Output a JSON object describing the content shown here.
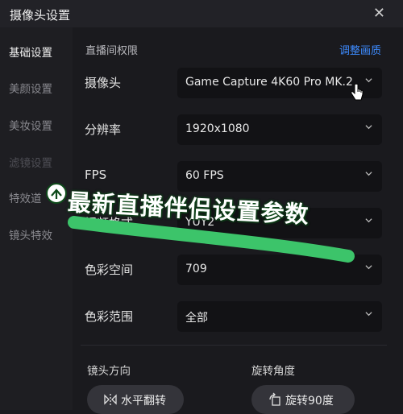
{
  "window": {
    "title": "摄像头设置",
    "close_glyph": "✕"
  },
  "sidebar": {
    "items": [
      {
        "label": "基础设置",
        "state": "active"
      },
      {
        "label": "美颜设置",
        "state": "normal"
      },
      {
        "label": "美妆设置",
        "state": "normal"
      },
      {
        "label": "滤镜设置",
        "state": "dim"
      },
      {
        "label": "特效道",
        "state": "normal"
      },
      {
        "label": "镜头特效",
        "state": "normal"
      }
    ]
  },
  "main": {
    "section_title": "直播间权限",
    "adjust_link": "调整画质",
    "fields": [
      {
        "label": "摄像头",
        "value": "Game Capture 4K60 Pro MK.2"
      },
      {
        "label": "分辨率",
        "value": "1920x1080"
      },
      {
        "label": "FPS",
        "value": "60 FPS"
      },
      {
        "label": "视频格式",
        "value": "YUY2"
      },
      {
        "label": "色彩空间",
        "value": "709"
      },
      {
        "label": "色彩范围",
        "value": "全部"
      }
    ],
    "lens_direction_label": "镜头方向",
    "rotation_label": "旋转角度",
    "flip_button": "水平翻转",
    "rotate_button": "旋转90度"
  },
  "overlay": {
    "banner_text": "最新直播伴侣设置参数",
    "banner_color": "#3cc46a"
  },
  "colors": {
    "accent": "#3d8bff",
    "background": "#1a1a1e"
  }
}
